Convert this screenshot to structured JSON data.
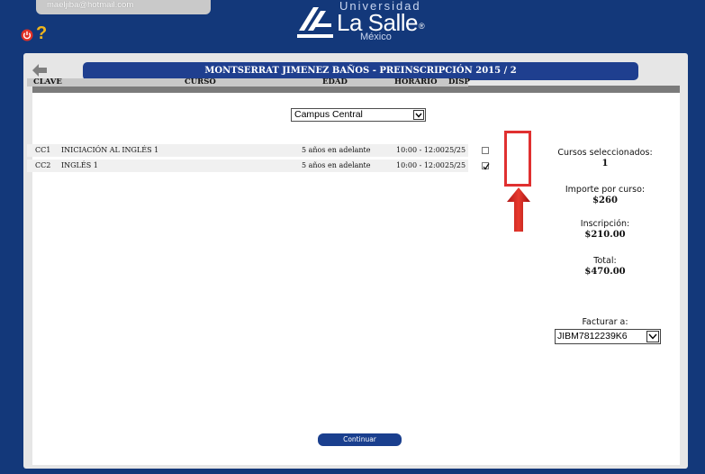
{
  "header": {
    "user_email": "maeljiba@hotmail.com",
    "help_symbol": "?",
    "logo": {
      "top_text": "Universidad",
      "name": "La Salle",
      "registered": "®",
      "country": "México"
    }
  },
  "title": "MONTSERRAT JIMENEZ BAÑOS - PREINSCRIPCIÓN 2015 / 2",
  "campus_select": {
    "value": "Campus Central"
  },
  "table": {
    "headers": {
      "clave": "CLAVE",
      "curso": "CURSO",
      "edad": "EDAD",
      "horario": "HORARIO",
      "disp": "DISP"
    },
    "rows": [
      {
        "clave": "CC1",
        "curso": "INICIACIÓN AL INGLÉS 1",
        "edad": "5 años en adelante",
        "horario": "10:00 - 12:00",
        "disp": "25/25",
        "checked": false
      },
      {
        "clave": "CC2",
        "curso": "INGLÉS 1",
        "edad": "5 años en adelante",
        "horario": "10:00 - 12:00",
        "disp": "25/25",
        "checked": true
      }
    ]
  },
  "summary": {
    "selected_label": "Cursos seleccionados:",
    "selected_value": "1",
    "price_label": "Importe por curso:",
    "price_value": "$260",
    "inscription_label": "Inscripción:",
    "inscription_value": "$210.00",
    "total_label": "Total:",
    "total_value": "$470.00"
  },
  "billing": {
    "label": "Facturar a:",
    "value": "JIBM7812239K6"
  },
  "continue_label": "Continuar",
  "colors": {
    "background": "#13387a",
    "accent": "#1f3f8f",
    "highlight": "#e03030",
    "help": "#f0b61d"
  }
}
